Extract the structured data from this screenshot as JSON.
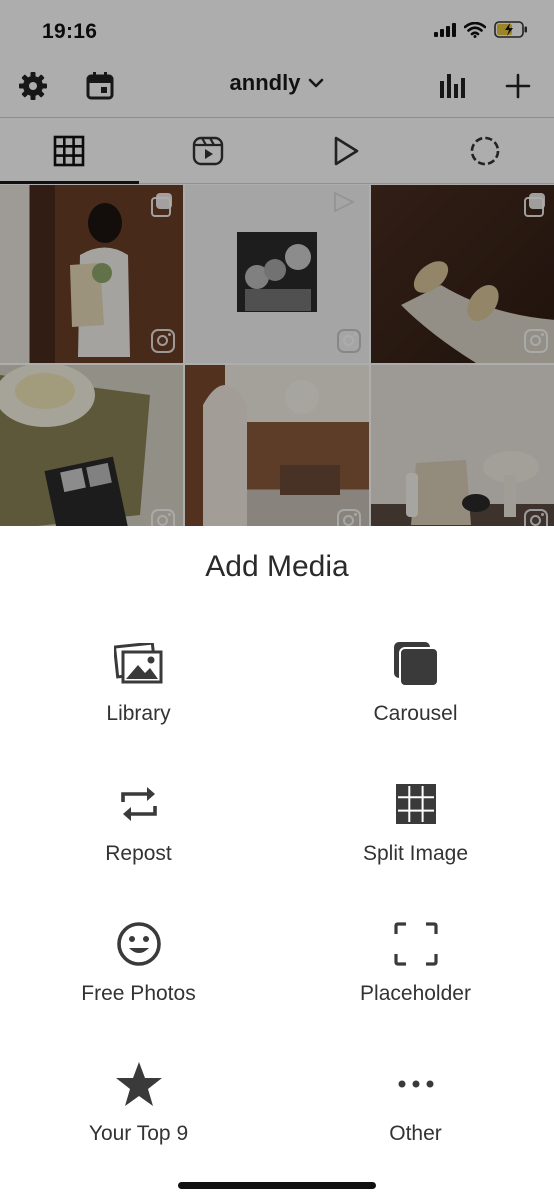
{
  "status_bar": {
    "time": "19:16"
  },
  "toolbar": {
    "account_name": "anndly",
    "icons": [
      "gear-icon",
      "calendar-icon",
      "chevron-down-icon",
      "stats-icon",
      "plus-icon"
    ]
  },
  "tabs": [
    {
      "name": "grid",
      "icon": "grid-icon",
      "active": true
    },
    {
      "name": "reels",
      "icon": "reels-icon",
      "active": false
    },
    {
      "name": "video",
      "icon": "play-icon",
      "active": false
    },
    {
      "name": "stories",
      "icon": "story-ring-icon",
      "active": false
    }
  ],
  "sheet": {
    "title": "Add Media",
    "options": [
      {
        "label": "Library",
        "icon": "photos-icon"
      },
      {
        "label": "Carousel",
        "icon": "carousel-icon"
      },
      {
        "label": "Repost",
        "icon": "repost-icon"
      },
      {
        "label": "Split Image",
        "icon": "split-grid-icon"
      },
      {
        "label": "Free Photos",
        "icon": "smiley-icon"
      },
      {
        "label": "Placeholder",
        "icon": "placeholder-frame-icon"
      },
      {
        "label": "Your Top 9",
        "icon": "star-icon"
      },
      {
        "label": "Other",
        "icon": "more-dots-icon"
      }
    ]
  },
  "colors": {
    "overlay": "#000000",
    "icon": "#3a3a3a",
    "sheet_bg": "#ffffff"
  }
}
